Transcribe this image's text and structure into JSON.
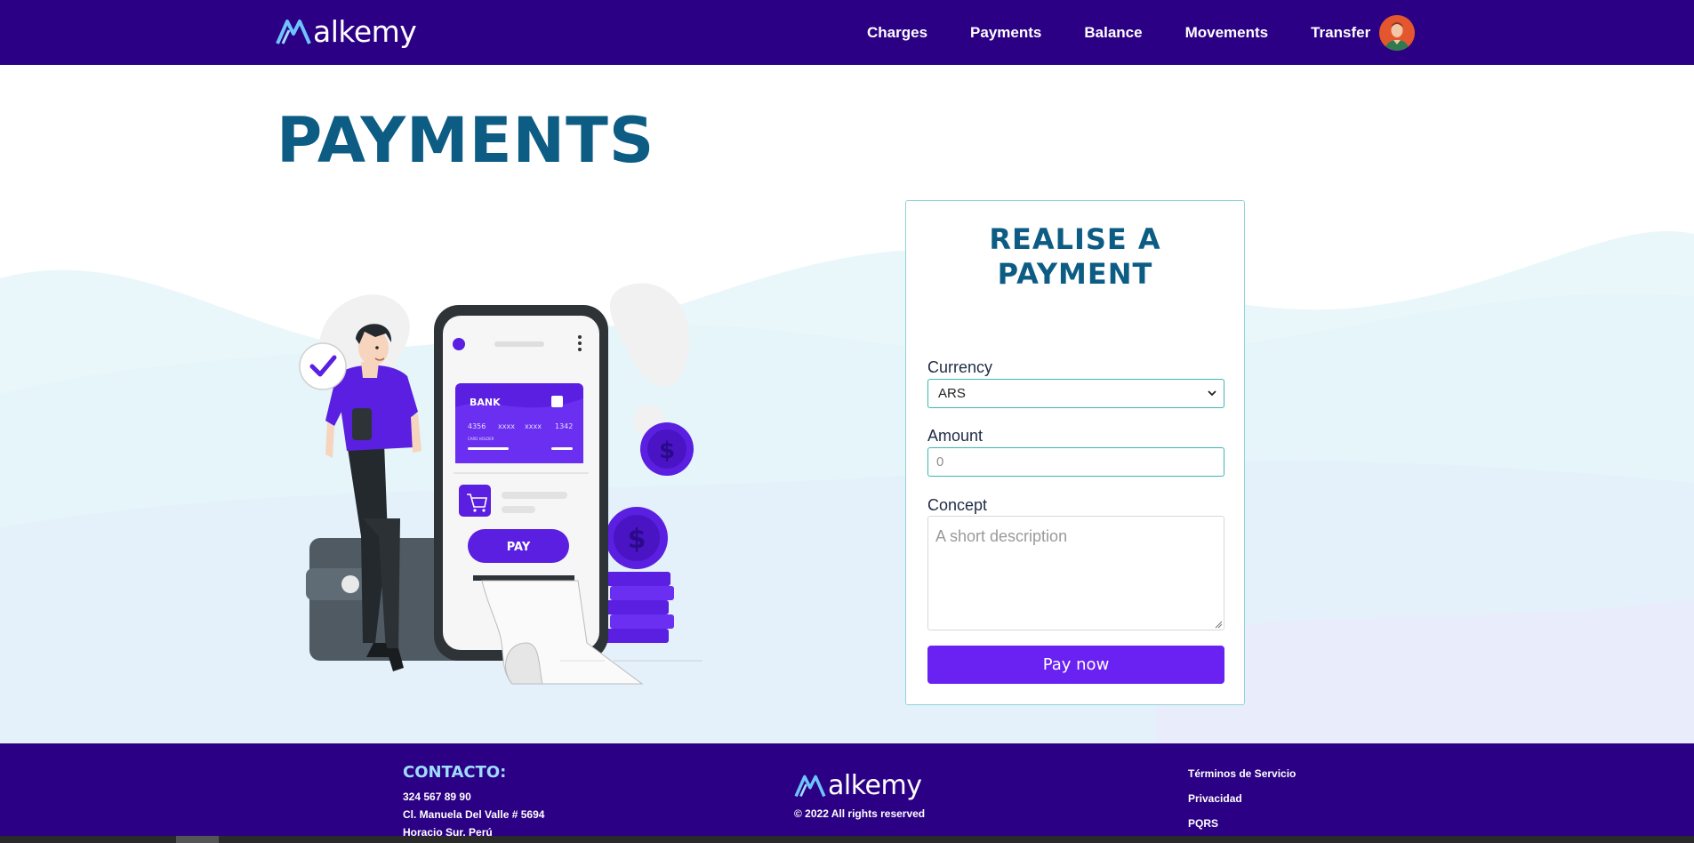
{
  "brand": {
    "name": "alkemy"
  },
  "nav": {
    "items": [
      {
        "label": "Charges"
      },
      {
        "label": "Payments"
      },
      {
        "label": "Balance"
      },
      {
        "label": "Movements"
      },
      {
        "label": "Transfer"
      }
    ]
  },
  "page": {
    "title": "PAYMENTS"
  },
  "illustration": {
    "card_bank": "BANK",
    "card_number": [
      "4356",
      "xxxx",
      "xxxx",
      "1342"
    ],
    "card_holder": "CARD HOLDER",
    "pay_button": "PAY",
    "coin_symbol": "$"
  },
  "form": {
    "title_line1": "REALISE A",
    "title_line2": "PAYMENT",
    "currency_label": "Currency",
    "currency_value": "ARS",
    "amount_label": "Amount",
    "amount_placeholder": "0",
    "concept_label": "Concept",
    "concept_placeholder": "A short description",
    "submit_label": "Pay now"
  },
  "footer": {
    "contact_heading": "CONTACTO:",
    "contact_lines": [
      "324 567 89 90",
      "Cl. Manuela Del Valle # 5694",
      "Horacio Sur, Perú"
    ],
    "copyright": "© 2022 All rights reserved",
    "links": [
      "Términos de Servicio",
      "Privacidad",
      "PQRS"
    ]
  },
  "colors": {
    "nav_bg": "#2b0084",
    "title": "#0d5c84",
    "accent": "#6a22f2",
    "field_border": "#3bb7b0",
    "footer_heading": "#9fdcff"
  }
}
